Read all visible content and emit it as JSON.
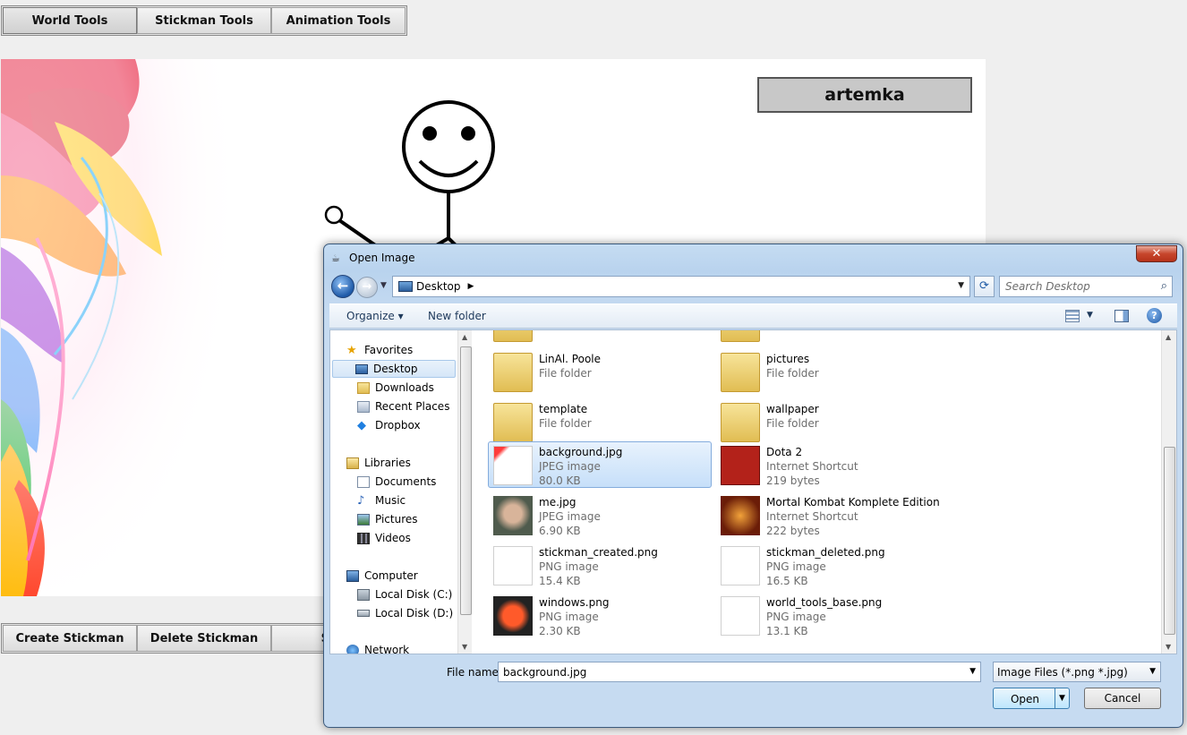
{
  "app": {
    "tabs": [
      "World Tools",
      "Stickman Tools",
      "Animation Tools"
    ],
    "username": "artemka",
    "bottom_buttons": [
      "Create Stickman",
      "Delete Stickman",
      "Set B"
    ]
  },
  "dialog": {
    "title": "Open Image",
    "close_glyph": "✕",
    "address": "Desktop",
    "search_placeholder": "Search Desktop",
    "organize": "Organize",
    "new_folder": "New folder",
    "help_glyph": "?",
    "nav": {
      "favorites": "Favorites",
      "desktop": "Desktop",
      "downloads": "Downloads",
      "recent": "Recent Places",
      "dropbox": "Dropbox",
      "libraries": "Libraries",
      "documents": "Documents",
      "music": "Music",
      "pictures": "Pictures",
      "videos": "Videos",
      "computer": "Computer",
      "disk_c": "Local Disk (C:)",
      "disk_d": "Local Disk (D:)",
      "network": "Network"
    },
    "files": [
      {
        "name": "",
        "type": "File folder",
        "size": ""
      },
      {
        "name": "",
        "type": "File folder",
        "size": ""
      },
      {
        "name": "LinAl. Poole",
        "type": "File folder",
        "size": ""
      },
      {
        "name": "pictures",
        "type": "File folder",
        "size": ""
      },
      {
        "name": "template",
        "type": "File folder",
        "size": ""
      },
      {
        "name": "wallpaper",
        "type": "File folder",
        "size": ""
      },
      {
        "name": "background.jpg",
        "type": "JPEG image",
        "size": "80.0 KB"
      },
      {
        "name": "Dota 2",
        "type": "Internet Shortcut",
        "size": "219 bytes"
      },
      {
        "name": "me.jpg",
        "type": "JPEG image",
        "size": "6.90 KB"
      },
      {
        "name": "Mortal Kombat Komplete Edition",
        "type": "Internet Shortcut",
        "size": "222 bytes"
      },
      {
        "name": "stickman_created.png",
        "type": "PNG image",
        "size": "15.4 KB"
      },
      {
        "name": "stickman_deleted.png",
        "type": "PNG image",
        "size": "16.5 KB"
      },
      {
        "name": "windows.png",
        "type": "PNG image",
        "size": "2.30 KB"
      },
      {
        "name": "world_tools_base.png",
        "type": "PNG image",
        "size": "13.1 KB"
      }
    ],
    "file_name_label": "File name:",
    "file_name_value": "background.jpg",
    "filter_value": "Image Files (*.png *.jpg)",
    "open_label": "Open",
    "cancel_label": "Cancel"
  }
}
